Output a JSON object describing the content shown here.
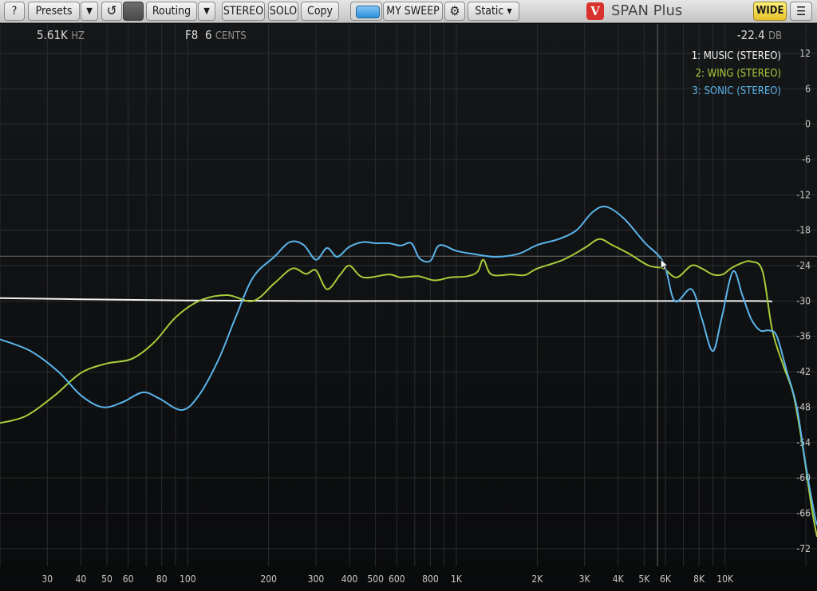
{
  "toolbar": {
    "help_label": "?",
    "presets_label": "Presets",
    "presets_arrow": "▼",
    "undo_icon": "↺",
    "routing_label": "Routing",
    "routing_arrow": "▼",
    "stereo_label": "STEREO",
    "solo_label": "SOLO",
    "copy_label": "Copy",
    "sweep_label": "MY SWEEP",
    "settings_icon": "⚙",
    "static_label": "Static ▾",
    "app_title": "SPAN Plus",
    "logo_text": "V",
    "wide_label": "WIDE",
    "menu_icon": "☰"
  },
  "readout": {
    "freq_value": "5.61K",
    "freq_unit": "HZ",
    "note_value": "F8",
    "cents_value": "6",
    "cents_unit": "CENTS",
    "level_value": "-22.4",
    "level_unit": "DB"
  },
  "colors": {
    "music": "#f2f2f2",
    "wing": "#a8cc3a",
    "sonic": "#5ab4ea",
    "grid": "#2a2c2e",
    "crosshair": "#6a6a6a"
  },
  "chart_data": {
    "type": "line",
    "x_scale": "log",
    "xlim": [
      20,
      22000
    ],
    "ylim": [
      -75,
      17
    ],
    "x_ticks": [
      {
        "value": 30,
        "label": "30"
      },
      {
        "value": 40,
        "label": "40"
      },
      {
        "value": 50,
        "label": "50"
      },
      {
        "value": 60,
        "label": "60"
      },
      {
        "value": 80,
        "label": "80"
      },
      {
        "value": 100,
        "label": "100"
      },
      {
        "value": 200,
        "label": "200"
      },
      {
        "value": 300,
        "label": "300"
      },
      {
        "value": 400,
        "label": "400"
      },
      {
        "value": 500,
        "label": "500"
      },
      {
        "value": 600,
        "label": "600"
      },
      {
        "value": 800,
        "label": "800"
      },
      {
        "value": 1000,
        "label": "1K"
      },
      {
        "value": 2000,
        "label": "2K"
      },
      {
        "value": 3000,
        "label": "3K"
      },
      {
        "value": 4000,
        "label": "4K"
      },
      {
        "value": 5000,
        "label": "5K"
      },
      {
        "value": 6000,
        "label": "6K"
      },
      {
        "value": 8000,
        "label": "8K"
      },
      {
        "value": 10000,
        "label": "10K"
      }
    ],
    "y_ticks": [
      12,
      6,
      0,
      -6,
      -12,
      -18,
      -24,
      -30,
      -36,
      -42,
      -48,
      -54,
      -60,
      -66,
      -72
    ],
    "crosshair": {
      "x": 5610,
      "y": -22.4
    },
    "series": [
      {
        "name": "1: MUSIC (STEREO)",
        "color": "#f2f2f2",
        "points": [
          [
            20,
            -29.5
          ],
          [
            40,
            -29.7
          ],
          [
            100,
            -29.9
          ],
          [
            300,
            -30.0
          ],
          [
            1000,
            -30.0
          ],
          [
            5000,
            -30.0
          ],
          [
            13000,
            -30.0
          ],
          [
            15000,
            -30.1
          ]
        ]
      },
      {
        "name": "2: WING (STEREO)",
        "color": "#a8cc3a",
        "points": [
          [
            20,
            -50.7
          ],
          [
            25,
            -49.5
          ],
          [
            32,
            -46
          ],
          [
            40,
            -42.2
          ],
          [
            50,
            -40.6
          ],
          [
            62,
            -39.8
          ],
          [
            75,
            -37
          ],
          [
            90,
            -32.8
          ],
          [
            110,
            -30
          ],
          [
            140,
            -29
          ],
          [
            175,
            -30
          ],
          [
            210,
            -27
          ],
          [
            245,
            -24.5
          ],
          [
            275,
            -25.4
          ],
          [
            300,
            -24.8
          ],
          [
            330,
            -28
          ],
          [
            370,
            -25.5
          ],
          [
            400,
            -24
          ],
          [
            450,
            -26
          ],
          [
            560,
            -25.5
          ],
          [
            620,
            -26
          ],
          [
            720,
            -25.8
          ],
          [
            830,
            -26.5
          ],
          [
            950,
            -26
          ],
          [
            1100,
            -25.8
          ],
          [
            1200,
            -25
          ],
          [
            1260,
            -23
          ],
          [
            1350,
            -25.5
          ],
          [
            1600,
            -25.5
          ],
          [
            1800,
            -25.6
          ],
          [
            2000,
            -24.5
          ],
          [
            2500,
            -23
          ],
          [
            3000,
            -21
          ],
          [
            3400,
            -19.5
          ],
          [
            3800,
            -20.5
          ],
          [
            4400,
            -22
          ],
          [
            5200,
            -24
          ],
          [
            5900,
            -24.5
          ],
          [
            6600,
            -26
          ],
          [
            7500,
            -24
          ],
          [
            8200,
            -24.5
          ],
          [
            9000,
            -25.5
          ],
          [
            9800,
            -25.5
          ],
          [
            10500,
            -24.5
          ],
          [
            11500,
            -23.6
          ],
          [
            12500,
            -23.3
          ],
          [
            13800,
            -25
          ],
          [
            15000,
            -35
          ],
          [
            16500,
            -41
          ],
          [
            18000,
            -46
          ],
          [
            19500,
            -55
          ],
          [
            21000,
            -65
          ],
          [
            22000,
            -70
          ]
        ]
      },
      {
        "name": "3: SONIC (STEREO)",
        "color": "#5ab4ea",
        "points": [
          [
            20,
            -36.5
          ],
          [
            26,
            -38.5
          ],
          [
            33,
            -42
          ],
          [
            40,
            -46
          ],
          [
            48,
            -48
          ],
          [
            57,
            -47.2
          ],
          [
            68,
            -45.5
          ],
          [
            78,
            -46.5
          ],
          [
            95,
            -48.5
          ],
          [
            110,
            -46
          ],
          [
            130,
            -40
          ],
          [
            150,
            -33
          ],
          [
            175,
            -26
          ],
          [
            210,
            -22.5
          ],
          [
            240,
            -20
          ],
          [
            270,
            -20.5
          ],
          [
            300,
            -23
          ],
          [
            330,
            -21
          ],
          [
            360,
            -22.5
          ],
          [
            400,
            -20.8
          ],
          [
            450,
            -20
          ],
          [
            500,
            -20.2
          ],
          [
            560,
            -20.2
          ],
          [
            620,
            -20.6
          ],
          [
            680,
            -20.2
          ],
          [
            730,
            -22.8
          ],
          [
            800,
            -23.2
          ],
          [
            850,
            -20.8
          ],
          [
            900,
            -20.6
          ],
          [
            1000,
            -21.5
          ],
          [
            1150,
            -22
          ],
          [
            1400,
            -22.5
          ],
          [
            1700,
            -22
          ],
          [
            2000,
            -20.5
          ],
          [
            2400,
            -19.5
          ],
          [
            2800,
            -18
          ],
          [
            3200,
            -15
          ],
          [
            3600,
            -14
          ],
          [
            4200,
            -16
          ],
          [
            5000,
            -20
          ],
          [
            5900,
            -23.5
          ],
          [
            6500,
            -30
          ],
          [
            7500,
            -28
          ],
          [
            8200,
            -33
          ],
          [
            9000,
            -38.5
          ],
          [
            9700,
            -33
          ],
          [
            10700,
            -25
          ],
          [
            11600,
            -29
          ],
          [
            12500,
            -33
          ],
          [
            13500,
            -35
          ],
          [
            14600,
            -35
          ],
          [
            15600,
            -36
          ],
          [
            17000,
            -42
          ],
          [
            18500,
            -48
          ],
          [
            20000,
            -58
          ],
          [
            21500,
            -66
          ],
          [
            22000,
            -68
          ]
        ]
      }
    ]
  }
}
